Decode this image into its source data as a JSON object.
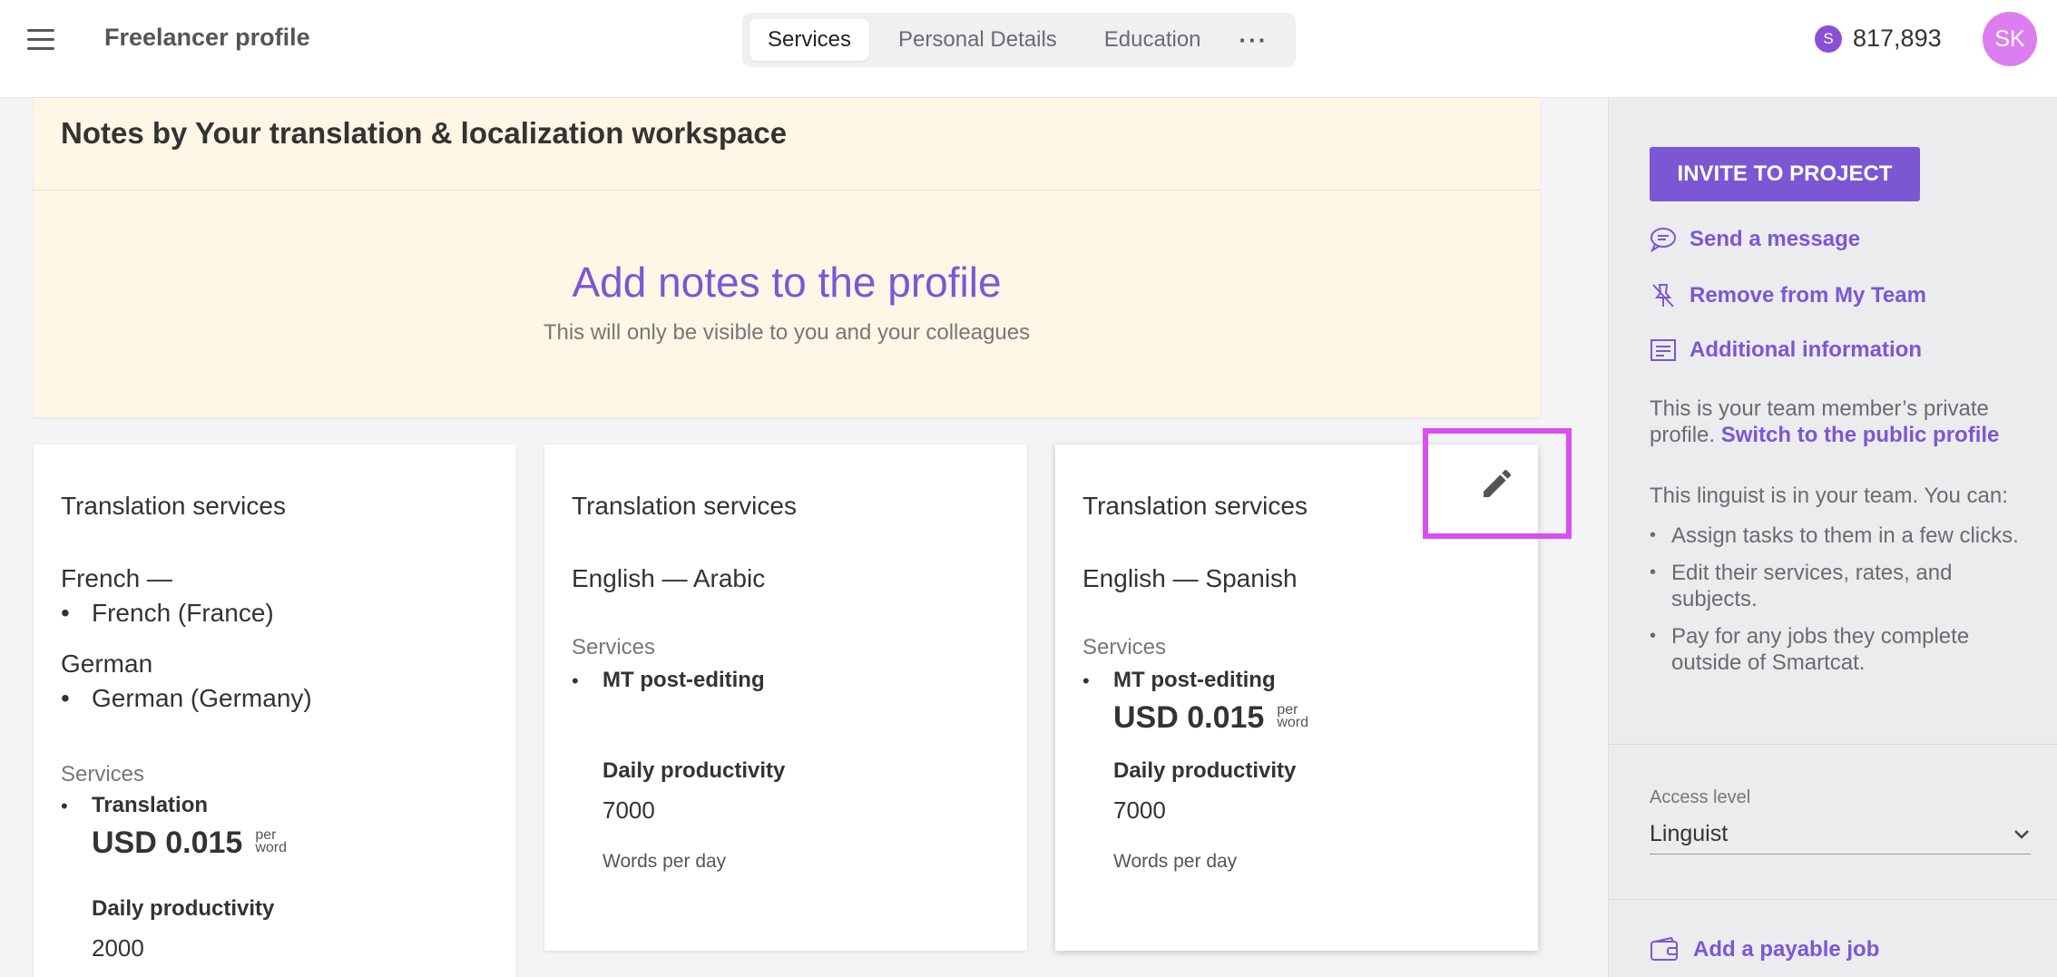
{
  "header": {
    "app_title": "Freelancer profile",
    "tabs": [
      {
        "label": "Services",
        "active": true
      },
      {
        "label": "Personal Details",
        "active": false
      },
      {
        "label": "Education",
        "active": false
      }
    ],
    "more_label": "···",
    "balance": "817,893",
    "balance_icon": "S",
    "avatar_initials": "SK",
    "avatar_color": "#dc7ef0",
    "accent_color": "#7b57d4"
  },
  "notes": {
    "title": "Notes by Your translation & localization workspace",
    "add_label": "Add notes to the profile",
    "subtitle": "This will only be visible to you and your colleagues"
  },
  "cards": [
    {
      "title": "Translation services",
      "languages": [
        {
          "pair": "French —",
          "variant": "French (France)"
        },
        {
          "pair": "German",
          "variant": "German (Germany)"
        }
      ],
      "services_label": "Services",
      "service": "Translation",
      "rate": "USD 0.015",
      "rate_unit_top": "per",
      "rate_unit_bottom": "word",
      "productivity_label": "Daily productivity",
      "productivity_value": "2000"
    },
    {
      "title": "Translation services",
      "pair": "English — Arabic",
      "services_label": "Services",
      "service": "MT post-editing",
      "productivity_label": "Daily productivity",
      "productivity_value": "7000",
      "productivity_unit": "Words per day"
    },
    {
      "title": "Translation services",
      "pair": "English — Spanish",
      "services_label": "Services",
      "service": "MT post-editing",
      "rate": "USD 0.015",
      "rate_unit_top": "per",
      "rate_unit_bottom": "word",
      "productivity_label": "Daily productivity",
      "productivity_value": "7000",
      "productivity_unit": "Words per day",
      "edit_icon": "pencil-icon"
    }
  ],
  "sidebar": {
    "invite_label": "INVITE TO PROJECT",
    "links": [
      {
        "label": "Send a message",
        "icon": "chat-icon"
      },
      {
        "label": "Remove from My Team",
        "icon": "unpin-icon"
      },
      {
        "label": "Additional information",
        "icon": "info-list-icon"
      }
    ],
    "private_text": "This is your team member’s private profile.",
    "public_link": "Switch to the public profile",
    "team_text": "This linguist is in your team. You can:",
    "team_items": [
      "Assign tasks to them in a few clicks.",
      "Edit their services, rates, and subjects.",
      "Pay for any jobs they complete outside of Smartcat."
    ],
    "access_label": "Access level",
    "access_value": "Linguist",
    "payable_label": "Add a payable job",
    "payable_icon": "wallet-icon"
  }
}
